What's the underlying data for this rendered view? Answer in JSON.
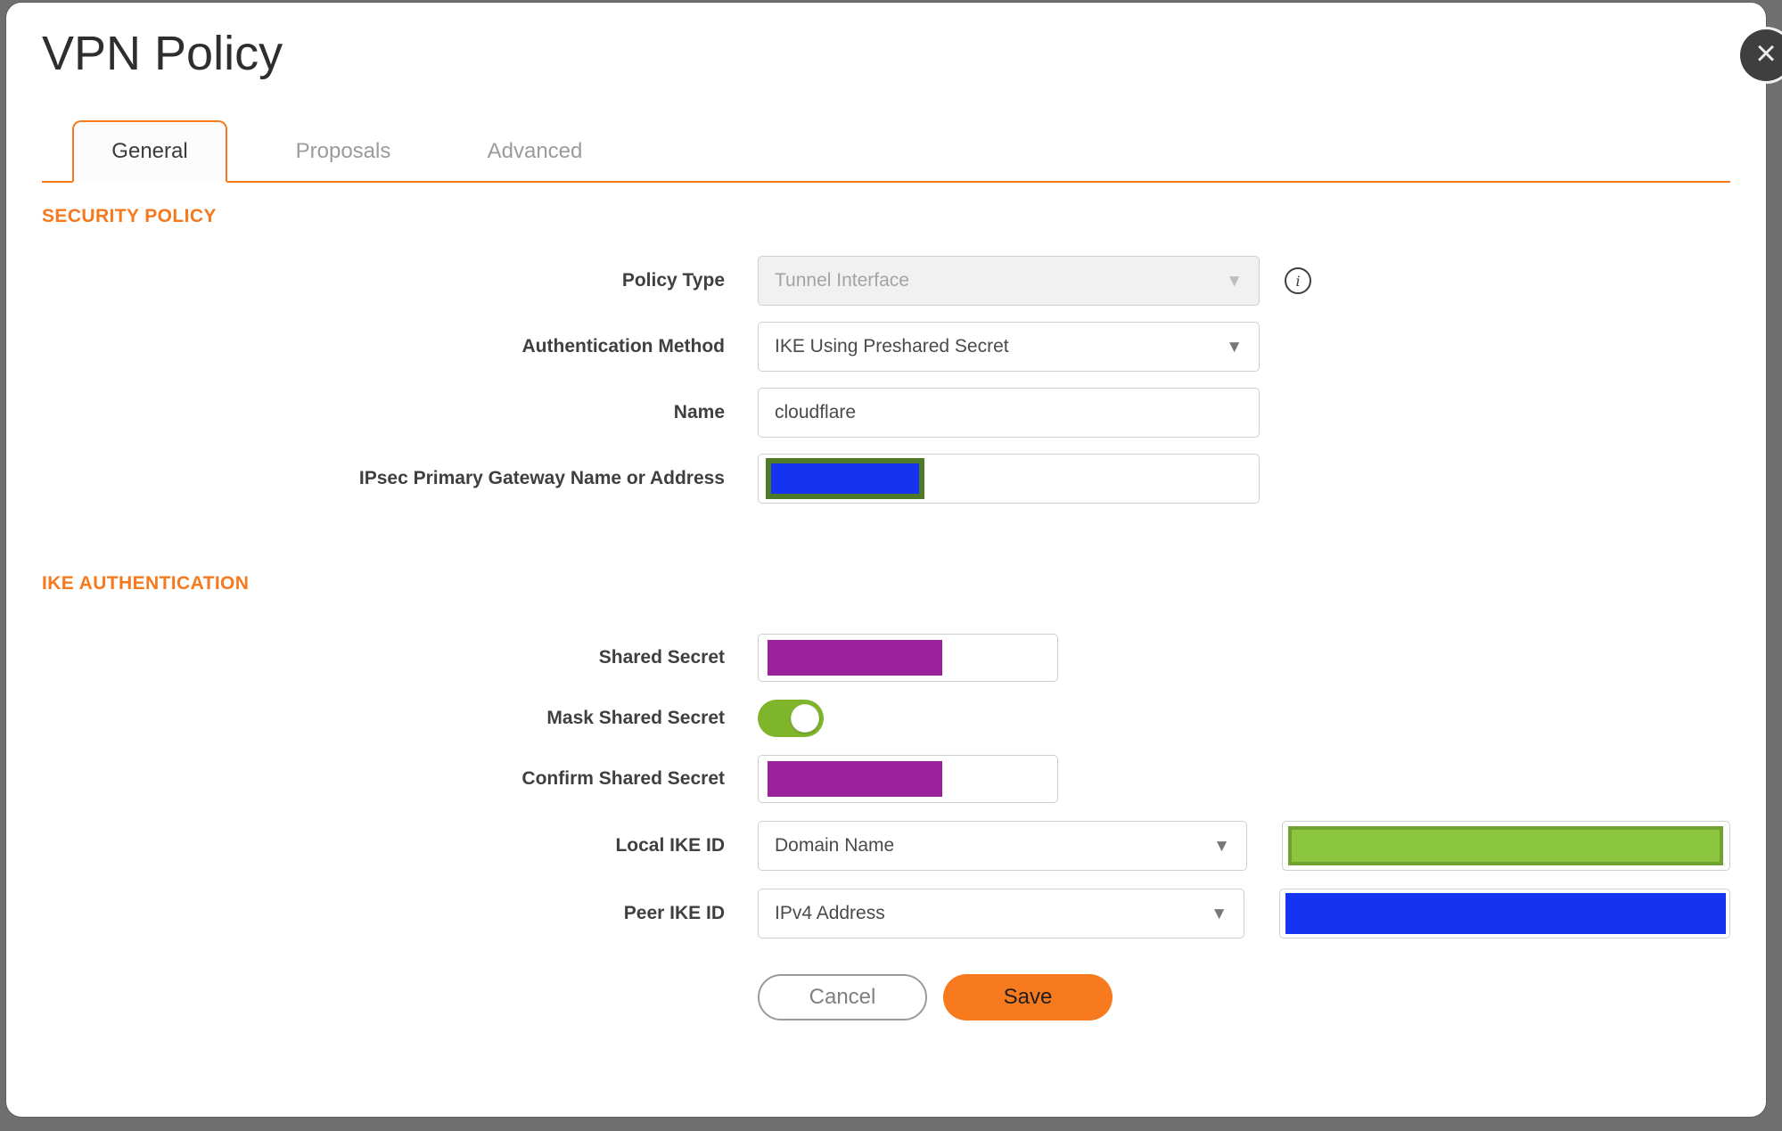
{
  "colors": {
    "accent": "#F7791E",
    "backdrop": "#6F6F6F",
    "save_bg": "#F77B1E",
    "toggle_on": "#7FB52B",
    "redact_blue": "#1533F0",
    "redact_blue_border": "#4E7A28",
    "redact_purple": "#9C219C",
    "redact_green": "#8CC63F",
    "redact_green_border": "#6FA231"
  },
  "icons": {
    "close": "×",
    "info": "i",
    "caret": "▼"
  },
  "dialog": {
    "title": "VPN Policy"
  },
  "tabs": [
    {
      "label": "General",
      "active": true
    },
    {
      "label": "Proposals",
      "active": false
    },
    {
      "label": "Advanced",
      "active": false
    }
  ],
  "security_policy": {
    "heading": "SECURITY POLICY",
    "policy_type": {
      "label": "Policy Type",
      "value": "Tunnel Interface",
      "state": "disabled"
    },
    "auth_method": {
      "label": "Authentication Method",
      "value": "IKE Using Preshared Secret"
    },
    "name": {
      "label": "Name",
      "value": "cloudflare"
    },
    "gateway": {
      "label": "IPsec Primary Gateway Name or Address",
      "value": ""
    }
  },
  "ike_authentication": {
    "heading": "IKE AUTHENTICATION",
    "shared_secret": {
      "label": "Shared Secret",
      "value": ""
    },
    "mask_shared_secret": {
      "label": "Mask Shared Secret",
      "state": "on"
    },
    "confirm_shared_secret": {
      "label": "Confirm Shared Secret",
      "value": ""
    },
    "local_ike_id": {
      "label": "Local IKE ID",
      "type": "Domain Name",
      "value": ""
    },
    "peer_ike_id": {
      "label": "Peer IKE ID",
      "type": "IPv4 Address",
      "value": ""
    }
  },
  "buttons": {
    "cancel": "Cancel",
    "save": "Save"
  }
}
